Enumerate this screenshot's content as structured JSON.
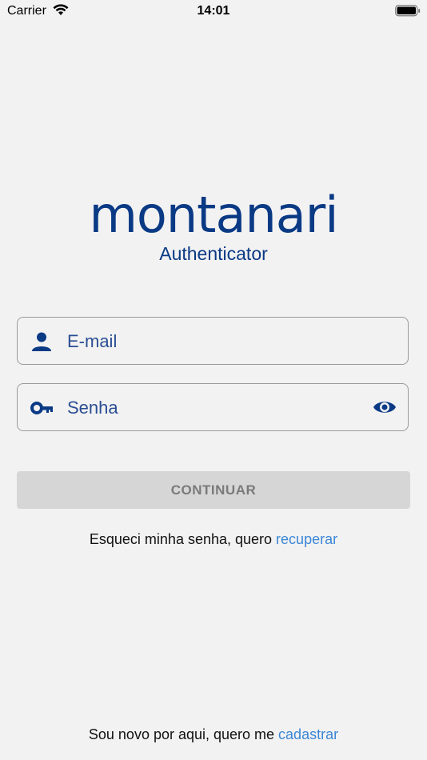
{
  "status_bar": {
    "carrier": "Carrier",
    "time": "14:01",
    "wifi_icon": "wifi-icon",
    "battery_icon": "battery-icon"
  },
  "logo": {
    "wordmark": "montanari",
    "subtitle": "Authenticator"
  },
  "form": {
    "email": {
      "placeholder": "E-mail",
      "value": "",
      "icon": "person-icon"
    },
    "password": {
      "placeholder": "Senha",
      "value": "",
      "icon": "key-icon",
      "toggle_icon": "eye-icon"
    },
    "continue_label": "CONTINUAR"
  },
  "forgot": {
    "text": "Esqueci minha senha, quero ",
    "link": "recuperar"
  },
  "signup": {
    "text": "Sou novo por aqui, quero me ",
    "link": "cadastrar"
  },
  "colors": {
    "brand": "#0b3a85",
    "link": "#3b86d6",
    "button_disabled_bg": "#d6d6d6",
    "background": "#f2f2f2"
  }
}
